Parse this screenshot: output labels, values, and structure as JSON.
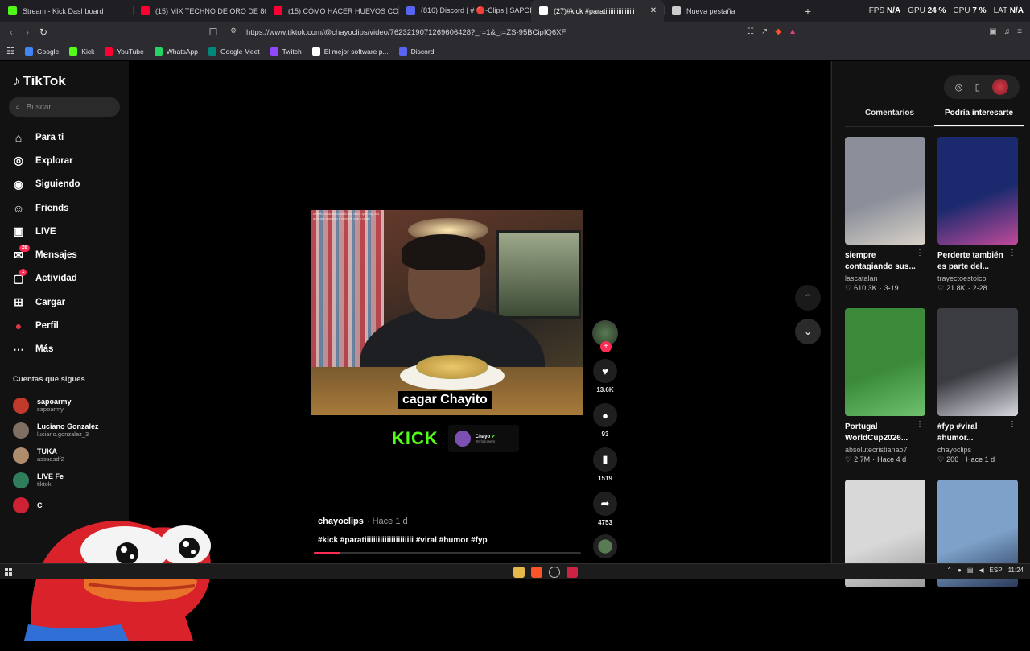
{
  "browser": {
    "tabs": [
      {
        "label": "Stream - Kick Dashboard",
        "icon": "kick-icon",
        "color": "#53fc18"
      },
      {
        "label": "(15) MIX TECHNO DE ORO DE 80's &",
        "icon": "youtube-icon",
        "color": "#ff0033"
      },
      {
        "label": "(15) CÓMO HACER HUEVOS COCIDO",
        "icon": "youtube-icon",
        "color": "#ff0033"
      },
      {
        "label": "(816) Discord | # 🔴-Clips | SAPOLIOS",
        "icon": "discord-icon",
        "color": "#5865f2"
      },
      {
        "label": "(27)#kick #paratiiiiiiiiiiiiiiiiii",
        "icon": "tiktok-icon",
        "color": "#ffffff",
        "active": true
      },
      {
        "label": "Nueva pestaña",
        "icon": "brave-icon",
        "color": "#cccccc"
      }
    ],
    "sys": {
      "fps_label": "FPS",
      "fps_value": "N/A",
      "gpu_label": "GPU",
      "gpu_value": "24 %",
      "cpu_label": "CPU",
      "cpu_value": "7 %",
      "lat_label": "LAT",
      "lat_value": "N/A"
    },
    "url": "https://www.tiktok.com/@chayoclips/video/7623219071269606428?_r=1&_t=ZS-95BCipIQ6XF",
    "bookmarks": [
      {
        "label": "Google",
        "color": "#4285f4"
      },
      {
        "label": "Kick",
        "color": "#53fc18"
      },
      {
        "label": "YouTube",
        "color": "#ff0033"
      },
      {
        "label": "WhatsApp",
        "color": "#25d366"
      },
      {
        "label": "Google Meet",
        "color": "#00897b"
      },
      {
        "label": "Twitch",
        "color": "#9146ff"
      },
      {
        "label": "El mejor software p...",
        "color": "#ffffff"
      },
      {
        "label": "Discord",
        "color": "#5865f2"
      }
    ]
  },
  "tiktok": {
    "brand": "TikTok",
    "search_placeholder": "Buscar",
    "nav": [
      {
        "label": "Para ti",
        "icon": "home-icon"
      },
      {
        "label": "Explorar",
        "icon": "compass-icon"
      },
      {
        "label": "Siguiendo",
        "icon": "following-icon"
      },
      {
        "label": "Friends",
        "icon": "friends-icon"
      },
      {
        "label": "LIVE",
        "icon": "live-icon"
      },
      {
        "label": "Mensajes",
        "icon": "messages-icon",
        "badge": "26"
      },
      {
        "label": "Actividad",
        "icon": "activity-icon",
        "badge": "1"
      },
      {
        "label": "Cargar",
        "icon": "upload-icon"
      },
      {
        "label": "Perfil",
        "icon": "profile-icon"
      },
      {
        "label": "Más",
        "icon": "more-icon"
      }
    ],
    "following_title": "Cuentas que sigues",
    "following": [
      {
        "name": "sapoarmy",
        "user": "sapoarmy",
        "color": "#c0392b"
      },
      {
        "name": "Luciano Gonzalez",
        "user": "luciano.gonzalez_3",
        "color": "#7f6f63"
      },
      {
        "name": "TUKA",
        "user": "asssasdf2",
        "color": "#b08c6e"
      },
      {
        "name": "LIVE Fe",
        "user": "tiktok",
        "color": "#2f7d5a"
      },
      {
        "name": "C",
        "user": "",
        "color": "#cc2233"
      }
    ],
    "video": {
      "overlay_text": "cagar Chayito",
      "kick_logo": "KICK",
      "kick_channel": "Chayo",
      "kick_followers": "2K followers",
      "author": "chayoclips",
      "ago": "· Hace 1 d",
      "tags": "#kick #paratiiiiiiiiiiiiiiiiiiiiii #viral #humor #fyp",
      "progress": 0.1
    },
    "actions": {
      "likes": "13.6K",
      "comments": "93",
      "saves": "1519",
      "shares": "4753"
    },
    "right": {
      "tabs": [
        "Comentarios",
        "Podría interesarte"
      ],
      "active_tab": "Podría interesarte",
      "cards": [
        {
          "title": "siempre contagiando sus...",
          "author": "lascatalan",
          "likes": "610.3K",
          "date": "3-19",
          "bg": "#8a8f9a",
          "accent": "#d9d2c8"
        },
        {
          "title": "Perderte también es parte del...",
          "author": "trayectoestoico",
          "likes": "21.8K",
          "date": "2-28",
          "bg": "#1b2a6e",
          "accent": "#c14a9a"
        },
        {
          "title": "Portugal WorldCup2026...",
          "author": "absolutecristianao7",
          "likes": "2.7M",
          "date": "Hace 4 d",
          "bg": "#3a8a3a",
          "accent": "#6fc06f"
        },
        {
          "title": "#fyp #viral #humor...",
          "author": "chayoclips",
          "likes": "206",
          "date": "Hace 1 d",
          "bg": "#3b3b42",
          "accent": "#d8d8e0"
        },
        {
          "title": "",
          "author": "",
          "likes": "",
          "date": "",
          "bg": "#d8d8d8",
          "accent": "#9a9a9a"
        },
        {
          "title": "",
          "author": "",
          "likes": "",
          "date": "",
          "bg": "#7da1c9",
          "accent": "#2a3a5a"
        }
      ]
    },
    "video_comment_text": "chayito mi amor cuando me dices que hoy vas a comer algo rico y luego te vas a cagar"
  },
  "taskbar": {
    "lang": "ESP",
    "time": "11:24"
  }
}
